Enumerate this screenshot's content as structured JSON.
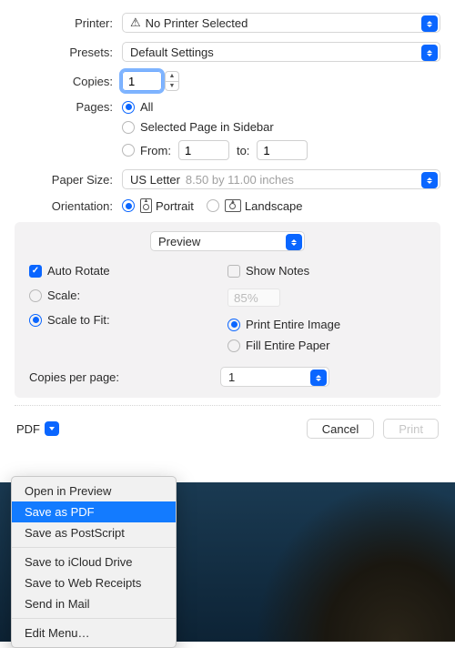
{
  "printer": {
    "label": "Printer:",
    "value": "No Printer Selected"
  },
  "presets": {
    "label": "Presets:",
    "value": "Default Settings"
  },
  "copies": {
    "label": "Copies:",
    "value": "1"
  },
  "pages": {
    "label": "Pages:",
    "all": "All",
    "selected": "Selected Page in Sidebar",
    "from_label": "From:",
    "from_value": "1",
    "to_label": "to:",
    "to_value": "1"
  },
  "paper": {
    "label": "Paper Size:",
    "value": "US Letter",
    "dims": "8.50 by 11.00 inches"
  },
  "orientation": {
    "label": "Orientation:",
    "portrait": "Portrait",
    "landscape": "Landscape"
  },
  "panel": {
    "app_select": "Preview",
    "auto_rotate": "Auto Rotate",
    "show_notes": "Show Notes",
    "scale": "Scale:",
    "scale_value": "85%",
    "scale_to_fit": "Scale to Fit:",
    "print_entire": "Print Entire Image",
    "fill_entire": "Fill Entire Paper",
    "copies_per_page": "Copies per page:",
    "cpp_value": "1"
  },
  "bottom": {
    "pdf": "PDF",
    "cancel": "Cancel",
    "print": "Print"
  },
  "menu": {
    "items": [
      "Open in Preview",
      "Save as PDF",
      "Save as PostScript",
      "Save to iCloud Drive",
      "Save to Web Receipts",
      "Send in Mail",
      "Edit Menu…"
    ],
    "selected_index": 1
  }
}
